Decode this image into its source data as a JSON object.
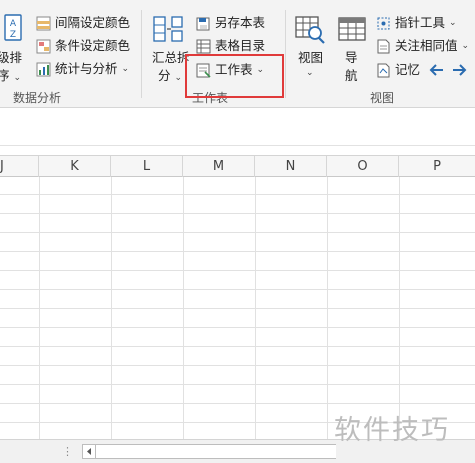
{
  "ribbon": {
    "sort_group": {
      "sort_button_label_line1": "级排",
      "sort_button_label_line2": "序",
      "group_title": "数据分析",
      "items": [
        {
          "label": "间隔设定颜色"
        },
        {
          "label": "条件设定颜色"
        },
        {
          "label": "统计与分析"
        }
      ]
    },
    "worksheet_group": {
      "summary_split_line1": "汇总拆",
      "summary_split_line2": "分",
      "items": [
        {
          "label": "另存本表"
        },
        {
          "label": "表格目录"
        },
        {
          "label": "工作表"
        }
      ],
      "group_title": "工作表"
    },
    "view_group": {
      "view_label": "视图",
      "nav_label_line1": "导",
      "nav_label_line2": "航",
      "items": [
        {
          "label": "指针工具"
        },
        {
          "label": "关注相同值"
        },
        {
          "label": "记忆"
        }
      ],
      "group_title": "视图"
    }
  },
  "grid": {
    "columns": [
      "J",
      "K",
      "L",
      "M",
      "N",
      "O",
      "P"
    ]
  },
  "watermark": "软件技巧",
  "colors": {
    "accent": "#2b6cb0",
    "highlight": "#e03a3a",
    "green": "#3c8f4e"
  }
}
